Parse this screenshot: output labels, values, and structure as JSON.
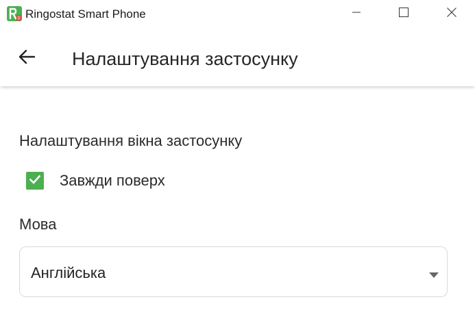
{
  "window": {
    "title": "Ringostat Smart Phone",
    "icons": {
      "app": "ringostat-logo-icon",
      "minimize": "minimize-icon",
      "maximize": "maximize-icon",
      "close": "close-icon"
    }
  },
  "header": {
    "back_icon": "arrow-left-icon",
    "title": "Налаштування застосунку"
  },
  "settings": {
    "window_section_title": "Налаштування вікна застосунку",
    "always_on_top": {
      "label": "Завжди поверх",
      "checked": true
    },
    "language": {
      "label": "Мова",
      "selected": "Англійська"
    }
  },
  "colors": {
    "accent_green": "#4caf50",
    "logo_red": "#e53935"
  }
}
